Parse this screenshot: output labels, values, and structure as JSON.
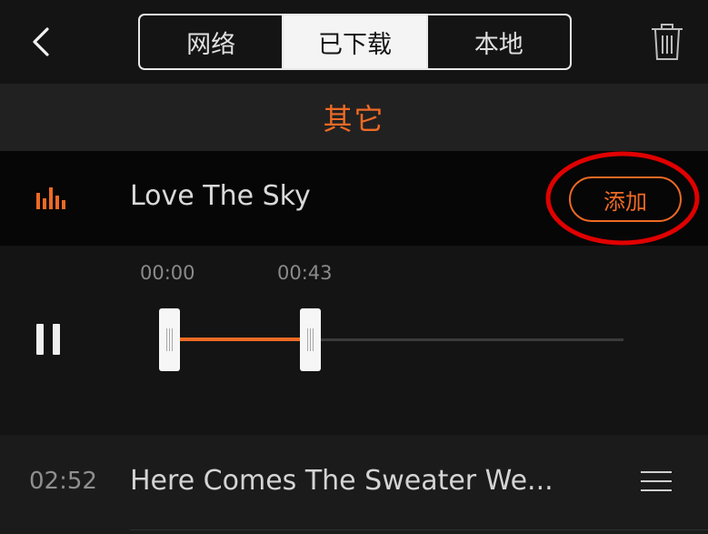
{
  "header": {
    "tabs": [
      {
        "label": "网络",
        "active": false
      },
      {
        "label": "已下载",
        "active": true
      },
      {
        "label": "本地",
        "active": false
      }
    ]
  },
  "section": {
    "title": "其它"
  },
  "current_song": {
    "title": "Love The Sky",
    "add_label": "添加",
    "trim": {
      "start_time": "00:00",
      "end_time": "00:43"
    }
  },
  "next_song": {
    "duration": "02:52",
    "title": "Here Comes The Sweater We..."
  },
  "colors": {
    "accent": "#ee6a25",
    "annotation": "#e00000",
    "background": "#121212"
  },
  "icons": {
    "back": "chevron-left-icon",
    "trash": "trash-icon",
    "playing": "equalizer-icon",
    "pause": "pause-icon",
    "menu": "hamburger-icon"
  }
}
